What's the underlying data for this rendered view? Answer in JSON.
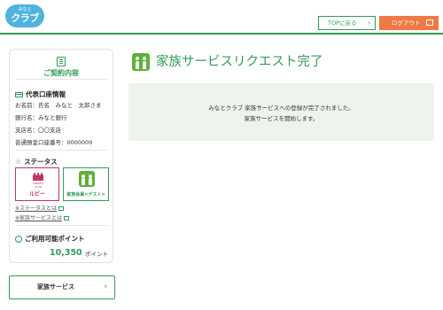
{
  "header": {
    "logo_small": "みなと",
    "logo_big": "クラブ",
    "top_button_label": "TOPに戻る",
    "logout_button_label": "ログアウト"
  },
  "sidebar": {
    "contract_title": "ご契約内容",
    "account_section": {
      "heading": "代表口座情報",
      "lines": [
        "お名前：氏名　みなと　太郎さま",
        "銀行名：みなと銀行",
        "支店名：〇〇支店",
        "普通預金口座番号：0000000"
      ]
    },
    "status_section": {
      "heading": "ステータス",
      "ruby_badge_label": "ルビー",
      "ruby_crown_text": "MINATO CLUB",
      "family_badge_label": "家族会員<ゲスト>",
      "links": [
        "※ステータスとは",
        "※家族サービスとは"
      ]
    },
    "points_section": {
      "heading": "ご利用可能ポイント",
      "value": "10,350",
      "unit": "ポイント"
    }
  },
  "family_service_button": {
    "label": "家族サービス"
  },
  "main": {
    "title": "家族サービスリクエスト完了",
    "message_line1": "みなとクラブ 家族サービスへの登録が完了されました。",
    "message_line2": "家族サービスを開始します。"
  },
  "colors": {
    "brand_green": "#2e9d55",
    "logout_orange": "#ee7a45",
    "ruby_red": "#c2336a",
    "logo_blue": "#4fb3e0",
    "message_bg": "#edf4ee"
  }
}
